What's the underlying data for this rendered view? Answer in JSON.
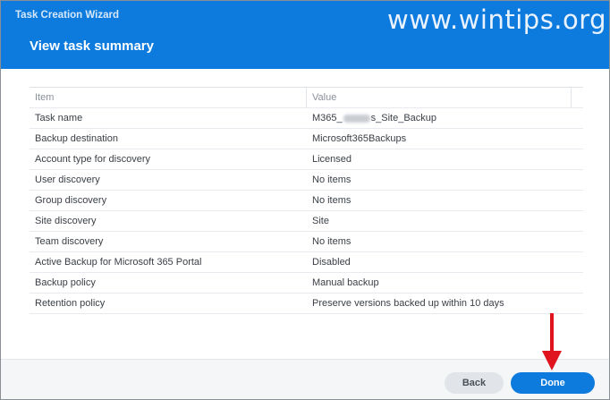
{
  "window": {
    "wizard_title": "Task Creation Wizard",
    "page_title": "View task summary",
    "watermark": "www.wintips.org"
  },
  "table": {
    "columns": [
      "Item",
      "Value"
    ],
    "rows": [
      {
        "item": "Task name",
        "value_prefix": "M365_",
        "value_suffix": "s_Site_Backup"
      },
      {
        "item": "Backup destination",
        "value": "Microsoft365Backups"
      },
      {
        "item": "Account type for discovery",
        "value": "Licensed"
      },
      {
        "item": "User discovery",
        "value": "No items"
      },
      {
        "item": "Group discovery",
        "value": "No items"
      },
      {
        "item": "Site discovery",
        "value": "Site"
      },
      {
        "item": "Team discovery",
        "value": "No items"
      },
      {
        "item": "Active Backup for Microsoft 365 Portal",
        "value": "Disabled"
      },
      {
        "item": "Backup policy",
        "value": "Manual backup"
      },
      {
        "item": "Retention policy",
        "value": "Preserve versions backed up within 10 days"
      }
    ]
  },
  "footer": {
    "back_label": "Back",
    "done_label": "Done"
  },
  "colors": {
    "accent": "#0d7bde",
    "annotation_arrow": "#e0141e"
  }
}
